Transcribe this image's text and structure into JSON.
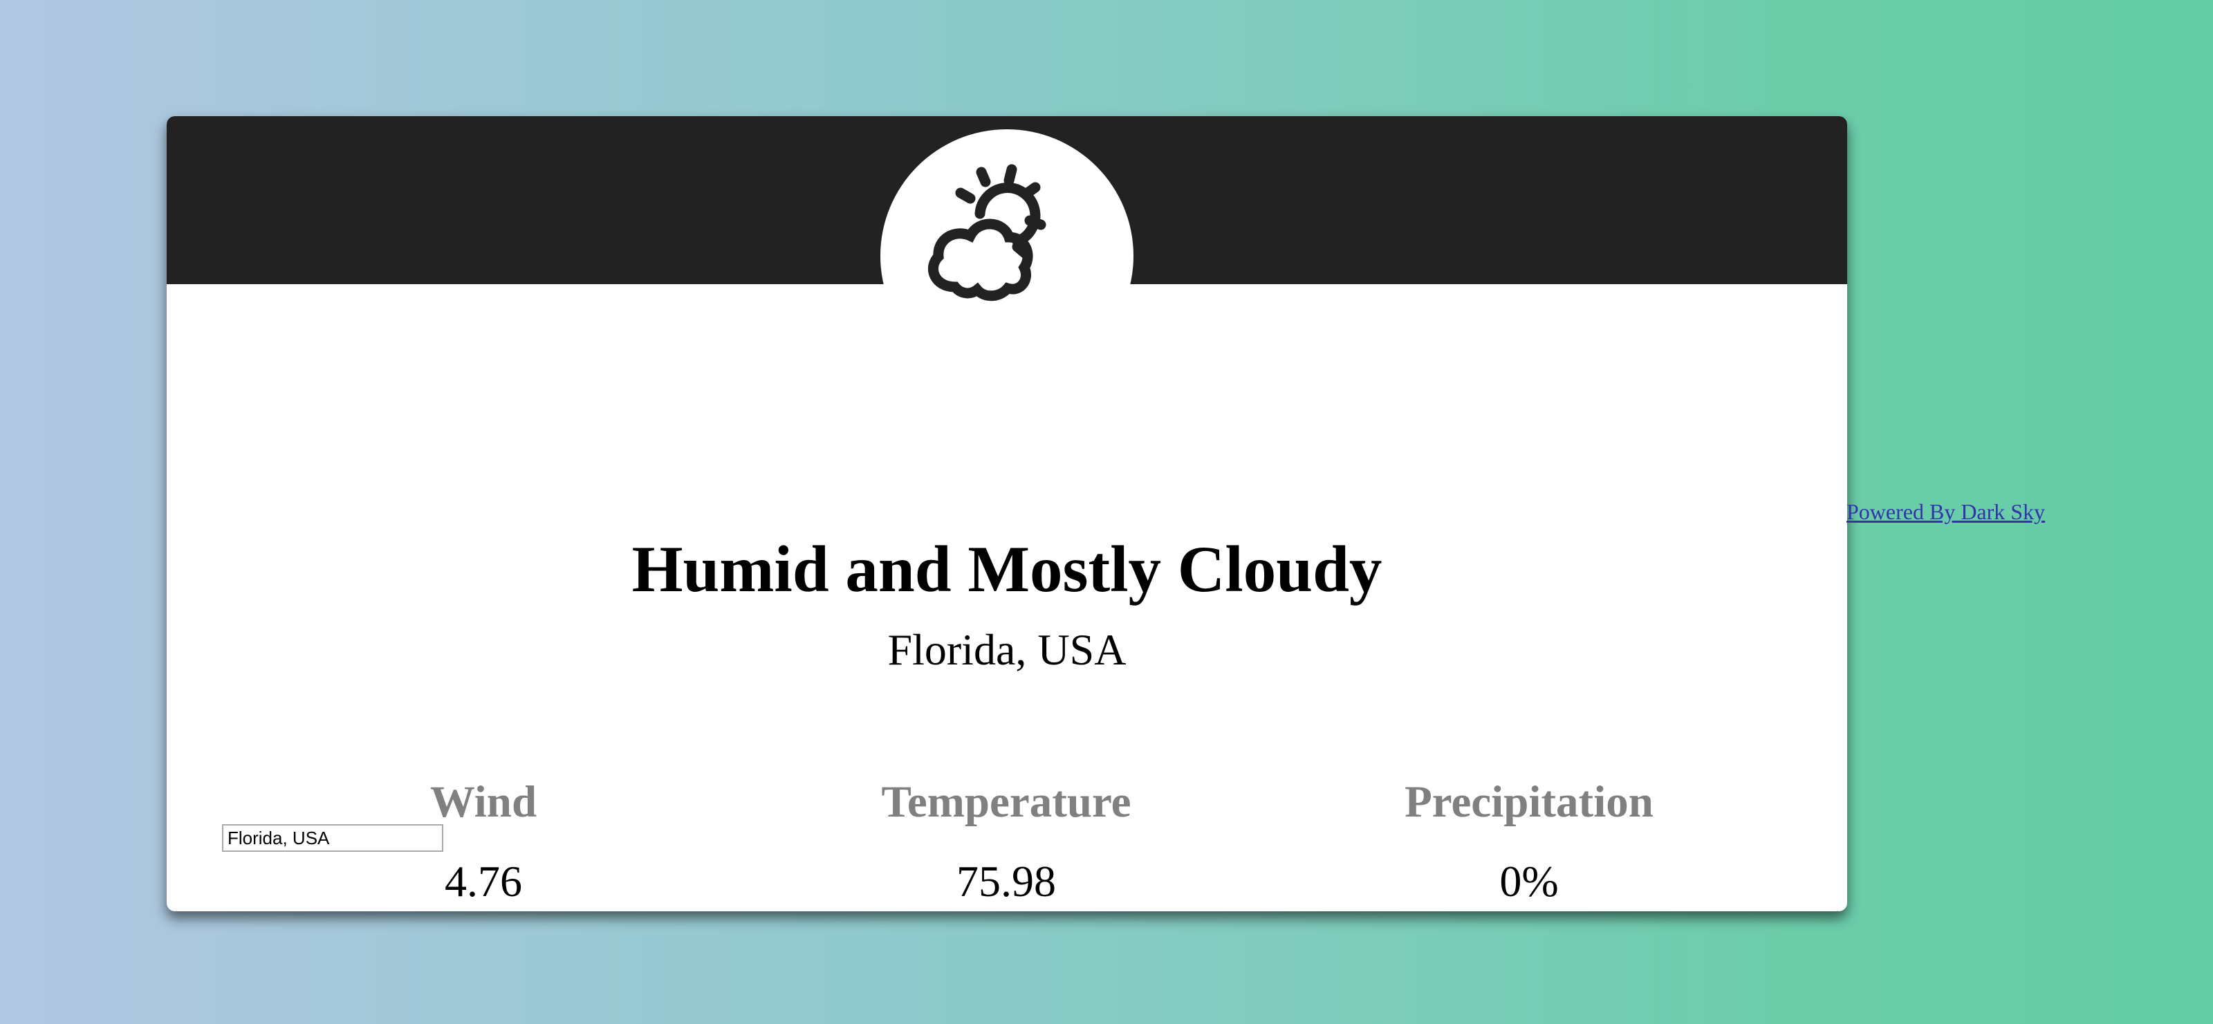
{
  "weather": {
    "icon": "partly-cloudy-day-icon",
    "summary": "Humid and Mostly Cloudy",
    "location": "Florida, USA"
  },
  "stats": {
    "wind": {
      "label": "Wind",
      "value": "4.76"
    },
    "temperature": {
      "label": "Temperature",
      "value": "75.98"
    },
    "precipitation": {
      "label": "Precipitation",
      "value": "0%"
    }
  },
  "search": {
    "value": "Florida, USA"
  },
  "footer": {
    "powered_by": "Powered By Dark Sky"
  },
  "colors": {
    "header": "#222222",
    "label_gray": "#808080",
    "gradient_start": "#b1c6e2",
    "gradient_end": "#63cda5"
  }
}
